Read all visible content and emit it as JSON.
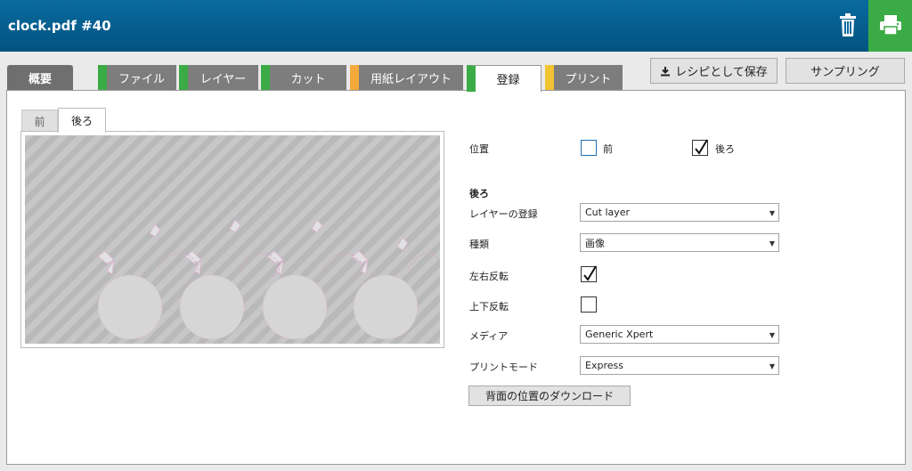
{
  "header": {
    "title": "clock.pdf #40",
    "trash_icon": "trash-icon",
    "print_icon": "printer-icon"
  },
  "tabs": [
    {
      "label": "概要"
    },
    {
      "label": "ファイル"
    },
    {
      "label": "レイヤー"
    },
    {
      "label": "カット"
    },
    {
      "label": "用紙レイアウト"
    },
    {
      "label": "登録"
    },
    {
      "label": "プリント"
    }
  ],
  "actions": {
    "save_recipe": "レシピとして保存",
    "sampling": "サンプリング"
  },
  "subtabs": {
    "front": "前",
    "back": "後ろ"
  },
  "form": {
    "position_label": "位置",
    "position_front": "前",
    "position_back": "後ろ",
    "section_title": "後ろ",
    "layer_reg_label": "レイヤーの登録",
    "layer_reg_value": "Cut layer",
    "type_label": "種類",
    "type_value": "画像",
    "mirror_lr_label": "左右反転",
    "mirror_ud_label": "上下反転",
    "media_label": "メディア",
    "media_value": "Generic Xpert",
    "print_mode_label": "プリントモード",
    "print_mode_value": "Express",
    "download_button": "背面の位置のダウンロード"
  },
  "colors": {
    "header": "#02547f",
    "print_button": "#3bab46",
    "tab_green": "#3bab46",
    "tab_orange": "#f4a93a",
    "tab_yellow": "#f1c232"
  }
}
